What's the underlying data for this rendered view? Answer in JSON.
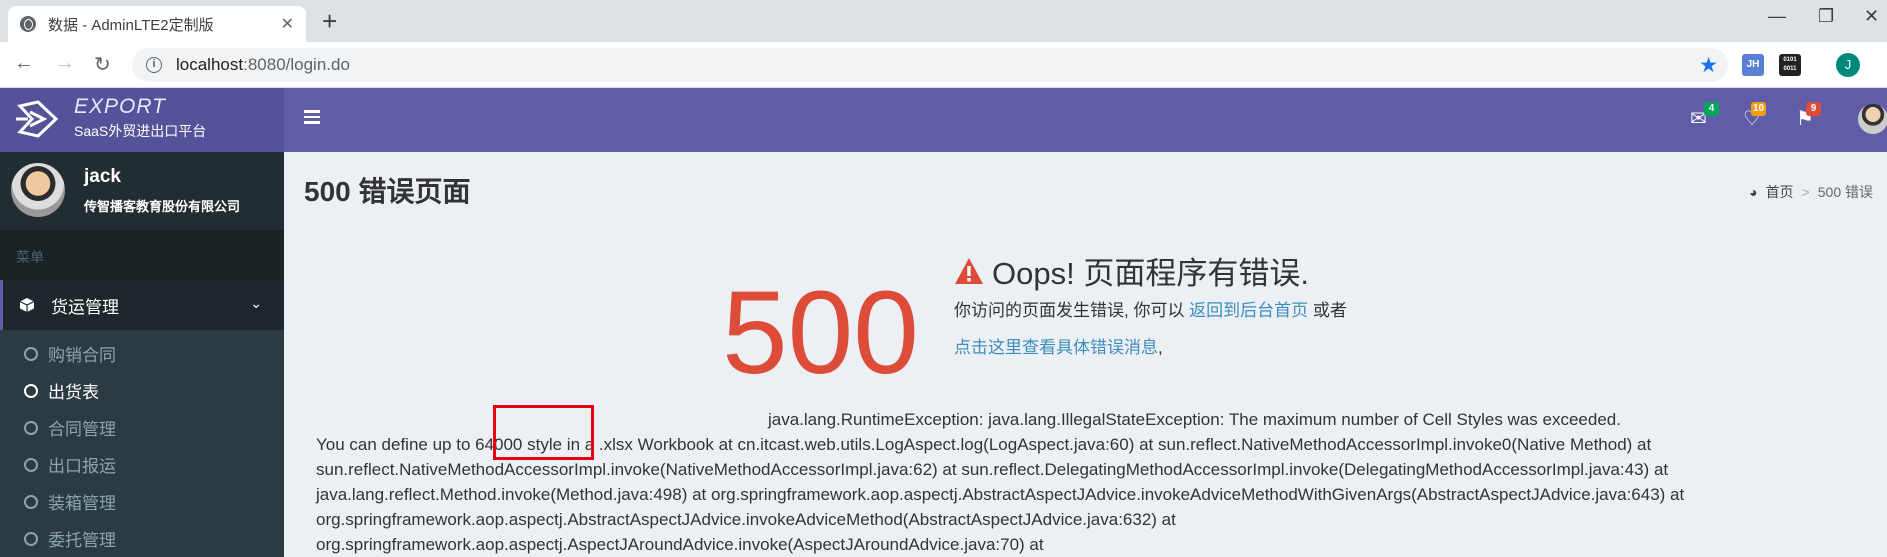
{
  "browser": {
    "tab_title": "数据 - AdminLTE2定制版",
    "tab_close": "✕",
    "new_tab": "+",
    "url_host": "localhost",
    "url_rest": ":8080/login.do",
    "window_min": "—",
    "window_max": "❐",
    "window_close": "✕",
    "ext1_label": "JH",
    "ext2_label": "0101 0011",
    "profile_initial": "J"
  },
  "header": {
    "logo_title": "EXPORT",
    "logo_subtitle": "SaaS外贸进出口平台",
    "mail_count": "4",
    "bell_count": "10",
    "flag_count": "9"
  },
  "sidebar": {
    "user_name": "jack",
    "company": "传智播客教育股份有限公司",
    "menu_header": "菜单",
    "group_label": "货运管理",
    "items": [
      {
        "label": "购销合同"
      },
      {
        "label": "出货表"
      },
      {
        "label": "合同管理"
      },
      {
        "label": "出口报运"
      },
      {
        "label": "装箱管理"
      },
      {
        "label": "委托管理"
      }
    ]
  },
  "content": {
    "page_title": "500 错误页面",
    "breadcrumb_home": "首页",
    "breadcrumb_sep": ">",
    "breadcrumb_current": "500 错误",
    "error_code": "500",
    "oops_title": "Oops! 页面程序有错误.",
    "line1_prefix": "你访问的页面发生错误, 你可以 ",
    "line1_link": "返回到后台首页",
    "line1_suffix": " 或者",
    "line2_link": "点击这里查看具体错误消息",
    "line2_suffix": ",",
    "stack_lines": [
      "java.lang.RuntimeException: java.lang.IllegalStateException: The maximum number of Cell Styles was exceeded.",
      "You can define up to 64000 style in a .xlsx Workbook at cn.itcast.web.utils.LogAspect.log(LogAspect.java:60) at sun.reflect.NativeMethodAccessorImpl.invoke0(Native Method) at",
      "sun.reflect.NativeMethodAccessorImpl.invoke(NativeMethodAccessorImpl.java:62) at sun.reflect.DelegatingMethodAccessorImpl.invoke(DelegatingMethodAccessorImpl.java:43) at",
      "java.lang.reflect.Method.invoke(Method.java:498) at org.springframework.aop.aspectj.AbstractAspectJAdvice.invokeAdviceMethodWithGivenArgs(AbstractAspectJAdvice.java:643) at",
      "org.springframework.aop.aspectj.AbstractAspectJAdvice.invokeAdviceMethod(AbstractAspectJAdvice.java:632) at",
      "org.springframework.aop.aspectj.AspectJAroundAdvice.invoke(AspectJAroundAdvice.java:70) at"
    ]
  }
}
